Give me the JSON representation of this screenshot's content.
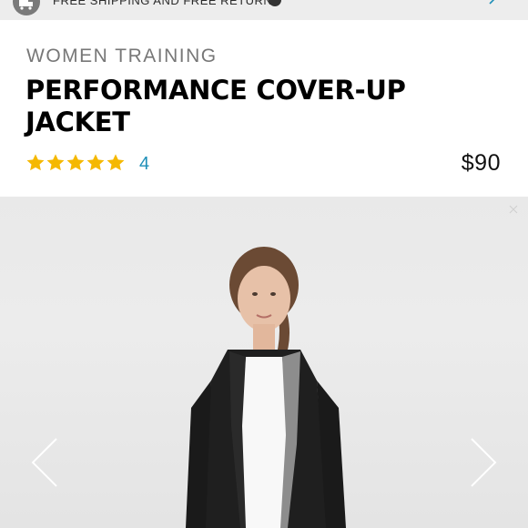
{
  "banner": {
    "text": "FREE SHIPPING AND FREE RETURNS",
    "truck_icon": "delivery-truck-icon",
    "help_icon": "question-icon",
    "expand_icon": "expand-arrows-icon"
  },
  "product": {
    "category": "WOMEN TRAINING",
    "title": "PERFORMANCE COVER-UP JACKET",
    "rating_stars": 5,
    "review_count": "4",
    "price": "$90"
  },
  "colors": {
    "star": "#f5b800",
    "review_link": "#1e8fb8",
    "banner_bg": "#ededed",
    "gallery_bg": "#e9e9e9"
  },
  "gallery": {
    "prev_icon": "chevron-left-icon",
    "next_icon": "chevron-right-icon"
  }
}
